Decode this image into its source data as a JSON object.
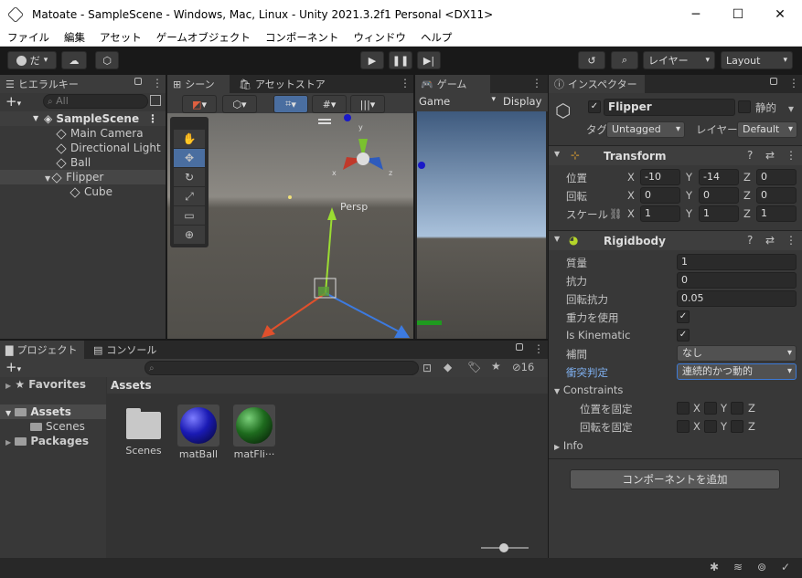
{
  "window": {
    "title": "Matoate - SampleScene - Windows, Mac, Linux - Unity 2021.3.2f1 Personal <DX11>",
    "minimize": "─",
    "maximize": "☐",
    "close": "✕"
  },
  "menu": [
    "ファイル",
    "編集",
    "アセット",
    "ゲームオブジェクト",
    "コンポーネント",
    "ウィンドウ",
    "ヘルプ"
  ],
  "toolbar": {
    "account": "だ",
    "layers": "レイヤー",
    "layout": "Layout"
  },
  "hierarchy": {
    "tab": "ヒエラルキー",
    "search_placeholder": "All",
    "scene": "SampleScene",
    "items": [
      "Main Camera",
      "Directional Light",
      "Ball",
      "Flipper",
      "Cube"
    ]
  },
  "scene_view": {
    "tab": "シーン",
    "store_tab": "アセットストア",
    "persp": "Persp",
    "gizmo_y": "y",
    "gizmo_x": "x",
    "gizmo_z": "z"
  },
  "game_view": {
    "tab": "ゲーム",
    "display": "Game",
    "display2": "Display"
  },
  "project": {
    "tab": "プロジェクト",
    "console_tab": "コンソール",
    "favorites": "Favorites",
    "assets": "Assets",
    "scenes": "Scenes",
    "packages": "Packages",
    "breadcrumb": "Assets",
    "hidden_count": "16",
    "files": [
      {
        "name": "Scenes",
        "type": "folder"
      },
      {
        "name": "matBall",
        "type": "sphere",
        "color": "#1a1ab4"
      },
      {
        "name": "matFli···",
        "type": "sphere",
        "color": "#1e6b1e"
      }
    ]
  },
  "inspector": {
    "tab": "インスペクター",
    "object_name": "Flipper",
    "static_label": "静的",
    "tag_label": "タグ",
    "tag_value": "Untagged",
    "layer_label": "レイヤー",
    "layer_value": "Default",
    "transform": {
      "title": "Transform",
      "position_label": "位置",
      "rotation_label": "回転",
      "scale_label": "スケール",
      "position": {
        "x": "-10",
        "y": "-14",
        "z": "0"
      },
      "rotation": {
        "x": "0",
        "y": "0",
        "z": "0"
      },
      "scale": {
        "x": "1",
        "y": "1",
        "z": "1"
      }
    },
    "rigidbody": {
      "title": "Rigidbody",
      "mass_label": "質量",
      "mass": "1",
      "drag_label": "抗力",
      "drag": "0",
      "angular_drag_label": "回転抗力",
      "angular_drag": "0.05",
      "use_gravity_label": "重力を使用",
      "is_kinematic_label": "Is Kinematic",
      "interpolate_label": "補間",
      "interpolate": "なし",
      "collision_label": "衝突判定",
      "collision": "連続的かつ動的",
      "constraints_label": "Constraints",
      "freeze_position_label": "位置を固定",
      "freeze_rotation_label": "回転を固定",
      "info_label": "Info"
    },
    "add_component": "コンポーネントを追加"
  }
}
